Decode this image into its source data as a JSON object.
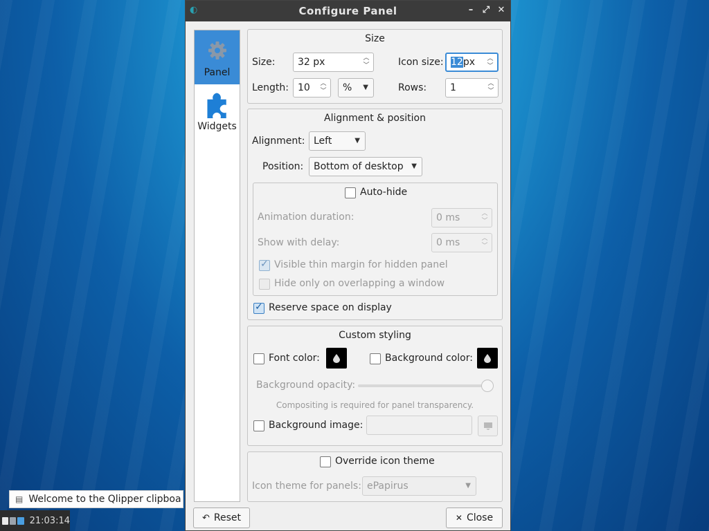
{
  "window": {
    "title": "Configure Panel",
    "controls": {
      "minimize": "–",
      "maximize": "⤢",
      "close": "✕"
    }
  },
  "nav": {
    "items": [
      {
        "label": "Panel",
        "icon": "gear-icon",
        "active": true
      },
      {
        "label": "Widgets",
        "icon": "puzzle-icon",
        "active": false
      }
    ]
  },
  "size_group": {
    "title": "Size",
    "size_label": "Size:",
    "size_value": "32 px",
    "icon_size_label": "Icon size:",
    "icon_size_number": "12",
    "icon_size_unit": " px",
    "length_label": "Length:",
    "length_value": "10",
    "length_unit": "%",
    "rows_label": "Rows:",
    "rows_value": "1"
  },
  "alignment_group": {
    "title": "Alignment & position",
    "alignment_label": "Alignment:",
    "alignment_value": "Left",
    "position_label": "Position:",
    "position_value": "Bottom of desktop",
    "autohide_label": "Auto-hide",
    "animation_label": "Animation duration:",
    "animation_value": "0 ms",
    "delay_label": "Show with delay:",
    "delay_value": "0 ms",
    "thin_margin_label": "Visible thin margin for hidden panel",
    "overlap_label": "Hide only on overlapping a window",
    "reserve_label": "Reserve space on display"
  },
  "styling_group": {
    "title": "Custom styling",
    "font_color_label": "Font color:",
    "bg_color_label": "Background color:",
    "opacity_label": "Background opacity:",
    "opacity_level": 1.0,
    "compositing_note": "Compositing is required for panel transparency.",
    "bg_image_label": "Background image:",
    "bg_image_value": ""
  },
  "icon_theme_group": {
    "override_label": "Override icon theme",
    "theme_label": "Icon theme for panels:",
    "theme_value": "ePapirus"
  },
  "buttons": {
    "reset": "Reset",
    "close": "Close"
  },
  "notification": {
    "text": "Welcome to the Qlipper clipboa"
  },
  "taskbar": {
    "clock": "21:03:14"
  },
  "colors": {
    "accent": "#3a8bd6",
    "titlebar": "#3b3b3b",
    "color_swatch": "#000000"
  }
}
